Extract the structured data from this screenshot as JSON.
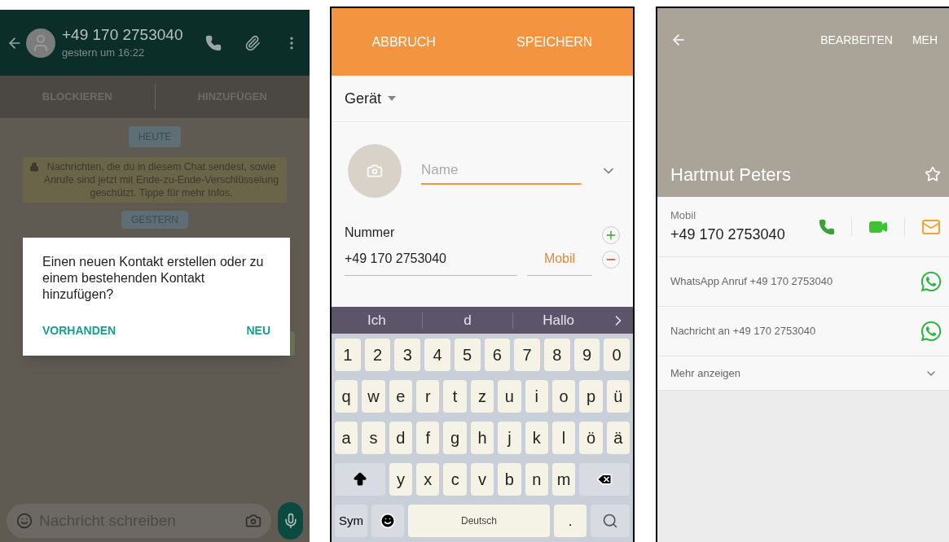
{
  "chat": {
    "contact": "+49 170 2753040",
    "last_seen": "gestern um 16:22",
    "actions": [
      "BLOCKIEREN",
      "HINZUFÜGEN"
    ],
    "date_chips": [
      "HEUTE",
      "GESTERN"
    ],
    "encryption_notice": "Nachrichten, die du in diesem Chat sendest, sowie Anrufe sind jetzt mit Ende-zu-Ende-Verschlüsselung geschützt. Tippe für mehr Infos.",
    "dialog": {
      "message": "Einen neuen Kontakt erstellen oder zu einem bestehenden Kontakt hinzufügen?",
      "buttons": [
        "VORHANDEN",
        "NEU"
      ]
    },
    "composer": {
      "placeholder": "Nachricht schreiben"
    }
  },
  "new_contact": {
    "toolbar": [
      "ABBRUCH",
      "SPEICHERN"
    ],
    "storage": "Gerät",
    "name_field": {
      "placeholder": "Name"
    },
    "number_label": "Nummer",
    "number_value": "+49 170 2753040",
    "number_type": "Mobil",
    "keyboard": {
      "suggestions": [
        "Ich",
        "d",
        "Hallo"
      ],
      "number_row": [
        "1",
        "2",
        "3",
        "4",
        "5",
        "6",
        "7",
        "8",
        "9",
        "0"
      ],
      "letter_rows": [
        [
          "q",
          "w",
          "e",
          "r",
          "t",
          "z",
          "u",
          "i",
          "o",
          "p",
          "ü"
        ],
        [
          "a",
          "s",
          "d",
          "f",
          "g",
          "h",
          "j",
          "k",
          "l",
          "ö",
          "ä"
        ],
        [
          "y",
          "x",
          "c",
          "v",
          "b",
          "n",
          "m"
        ]
      ],
      "sym_key": "Sym",
      "space_key": "Deutsch",
      "period_key": "."
    }
  },
  "contact_details": {
    "actions": [
      "BEARBEITEN",
      "MEH"
    ],
    "name": "Hartmut Peters",
    "number_label": "Mobil",
    "number": "+49 170 2753040",
    "rows": [
      {
        "kind": "whatsapp",
        "label": "WhatsApp Anruf +49 170 2753040"
      },
      {
        "kind": "whatsapp",
        "label": "Nachricht an +49 170 2753040"
      },
      {
        "kind": "expand",
        "label": "Mehr anzeigen"
      }
    ]
  }
}
